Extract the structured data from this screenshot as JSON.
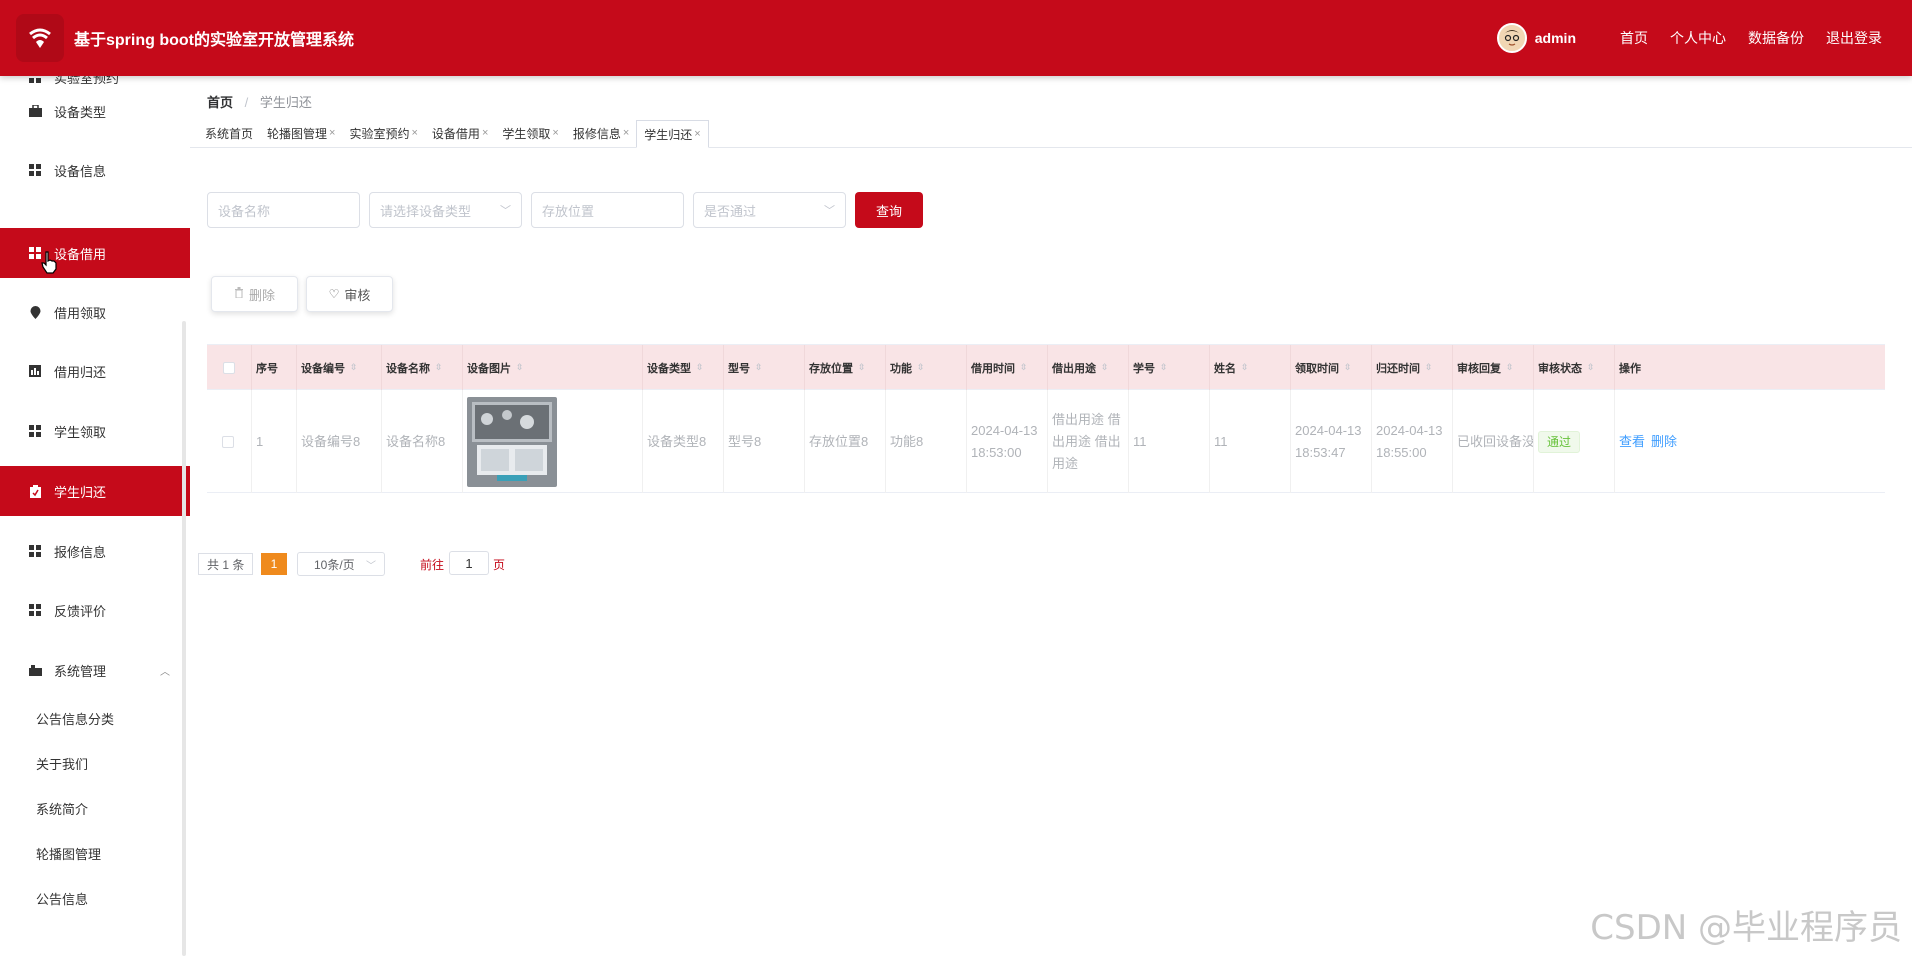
{
  "header": {
    "title": "基于spring boot的实验室开放管理系统",
    "user": "admin",
    "links": [
      "首页",
      "个人中心",
      "数据备份",
      "退出登录"
    ]
  },
  "sidebar": {
    "partial_top": "实验室预约",
    "items": [
      {
        "label": "设备类型",
        "icon": "briefcase-icon"
      },
      {
        "label": "设备信息",
        "icon": "grid-icon"
      },
      {
        "label": "设备借用",
        "icon": "grid-icon",
        "active": true
      },
      {
        "label": "借用领取",
        "icon": "map-pin-icon"
      },
      {
        "label": "借用归还",
        "icon": "chart-icon"
      },
      {
        "label": "学生领取",
        "icon": "grid-icon"
      },
      {
        "label": "学生归还",
        "icon": "clipboard-icon",
        "active": true
      },
      {
        "label": "报修信息",
        "icon": "grid-icon"
      },
      {
        "label": "反馈评价",
        "icon": "grid-icon"
      }
    ],
    "system": {
      "label": "系统管理",
      "children": [
        "公告信息分类",
        "关于我们",
        "系统简介",
        "轮播图管理",
        "公告信息"
      ]
    }
  },
  "breadcrumb": {
    "home": "首页",
    "current": "学生归还"
  },
  "tabs": [
    {
      "label": "系统首页",
      "closable": false
    },
    {
      "label": "轮播图管理",
      "closable": true
    },
    {
      "label": "实验室预约",
      "closable": true
    },
    {
      "label": "设备借用",
      "closable": true
    },
    {
      "label": "学生领取",
      "closable": true
    },
    {
      "label": "报修信息",
      "closable": true
    },
    {
      "label": "学生归还",
      "closable": true,
      "active": true
    }
  ],
  "filters": {
    "device_name_placeholder": "设备名称",
    "device_type_placeholder": "请选择设备类型",
    "location_placeholder": "存放位置",
    "approved_placeholder": "是否通过",
    "query_label": "查询"
  },
  "actions": {
    "delete_label": "删除",
    "audit_label": "审核"
  },
  "table": {
    "columns": [
      "序号",
      "设备编号",
      "设备名称",
      "设备图片",
      "设备类型",
      "型号",
      "存放位置",
      "功能",
      "借用时间",
      "借出用途",
      "学号",
      "姓名",
      "领取时间",
      "归还时间",
      "审核回复",
      "审核状态",
      "操作"
    ],
    "rows": [
      {
        "index": "1",
        "device_no": "设备编号8",
        "device_name": "设备名称8",
        "device_type": "设备类型8",
        "model": "型号8",
        "location": "存放位置8",
        "function": "功能8",
        "borrow_time": "2024-04-13 18:53:00",
        "purpose": "借出用途 借出用途 借出用途",
        "student_no": "11",
        "name": "11",
        "receive_time": "2024-04-13 18:53:47",
        "return_time": "2024-04-13 18:55:00",
        "reply": "已收回设备没",
        "status": "通过",
        "op_view": "查看",
        "op_delete": "删除"
      }
    ]
  },
  "pagination": {
    "total": "共 1 条",
    "current": "1",
    "page_size": "10条/页",
    "goto": "前往",
    "goto_value": "1",
    "page_suffix": "页"
  },
  "watermark": "CSDN @毕业程序员",
  "colors": {
    "brand": "#c50a1a",
    "header_row": "#f9e4e6",
    "pager_active": "#ef8a1d",
    "success": "#67c23a",
    "link": "#409eff"
  }
}
